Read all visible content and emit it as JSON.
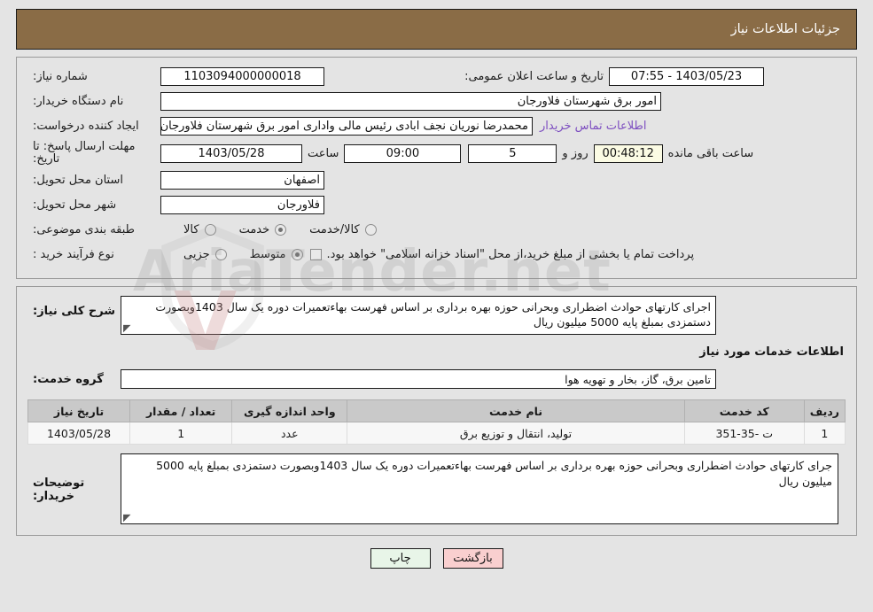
{
  "header": {
    "title": "جزئیات اطلاعات نیاز"
  },
  "form": {
    "need_number_label": "شماره نیاز:",
    "need_number_value": "1103094000000018",
    "public_announce_label": "تاریخ و ساعت اعلان عمومی:",
    "public_announce_value": "1403/05/23 - 07:55",
    "buyer_org_label": "نام دستگاه خریدار:",
    "buyer_org_value": "امور برق شهرستان فلاورجان",
    "requester_label": "ایجاد کننده درخواست:",
    "requester_value": "محمدرضا نوریان نجف ابادی رئیس مالی واداری  امور برق شهرستان فلاورجان",
    "buyer_contact_link": "اطلاعات تماس خریدار",
    "deadline_label": "مهلت ارسال پاسخ: تا تاریخ:",
    "deadline_date": "1403/05/28",
    "hour_label": "ساعت",
    "hour_value": "09:00",
    "days_value": "5",
    "days_label": "روز و",
    "countdown_value": "00:48:12",
    "remaining_label": "ساعت باقی مانده",
    "province_label": "استان محل تحویل:",
    "province_value": "اصفهان",
    "city_label": "شهر محل تحویل:",
    "city_value": "فلاورجان",
    "category_label": "طبقه بندی موضوعی:",
    "category_options": [
      {
        "label": "کالا",
        "selected": false
      },
      {
        "label": "خدمت",
        "selected": true
      },
      {
        "label": "کالا/خدمت",
        "selected": false
      }
    ],
    "process_label": "نوع فرآیند خرید :",
    "process_options": [
      {
        "label": "جزیی",
        "selected": false
      },
      {
        "label": "متوسط",
        "selected": true
      }
    ],
    "treasury_checkbox_label": "پرداخت تمام یا بخشی از مبلغ خرید،از محل \"اسناد خزانه اسلامی\" خواهد بود.",
    "treasury_checked": false
  },
  "description": {
    "summary_label": "شرح کلی نیاز:",
    "summary_value": "اجرای کارتهای حوادث اضطراری وبحرانی حوزه بهره برداری بر اساس فهرست بهاءتعمیرات دوره یک سال 1403وبصورت دستمزدی بمبلغ پایه 5000 میلیون ریال",
    "services_section_title": "اطلاعات خدمات مورد نیاز",
    "service_group_label": "گروه خدمت:",
    "service_group_value": "تامین برق، گاز، بخار و تهویه هوا"
  },
  "table": {
    "columns": [
      "ردیف",
      "کد خدمت",
      "نام خدمت",
      "واحد اندازه گیری",
      "تعداد / مقدار",
      "تاریخ نیاز"
    ],
    "rows": [
      {
        "radif": "1",
        "code": "ت -35-351",
        "name": "تولید، انتقال و توزیع برق",
        "unit": "عدد",
        "qty": "1",
        "date": "1403/05/28"
      }
    ]
  },
  "buyer_note": {
    "label": "توضیحات خریدار:",
    "value": "جرای کارتهای حوادث اضطراری وبحرانی حوزه بهره برداری بر اساس فهرست بهاءتعمیرات دوره یک سال  1403وبصورت دستمزدی بمبلغ پایه 5000 میلیون ریال"
  },
  "footer": {
    "print_label": "چاپ",
    "back_label": "بازگشت"
  },
  "watermark": {
    "text": "AriaTender.net"
  },
  "colors": {
    "header_bg": "#8a6c46",
    "link": "#7d4ec0",
    "timer_bg": "#fbfbe4",
    "print_btn": "#e8f5e8",
    "back_btn": "#f9cfcf",
    "table_header": "#c9c9c9"
  }
}
